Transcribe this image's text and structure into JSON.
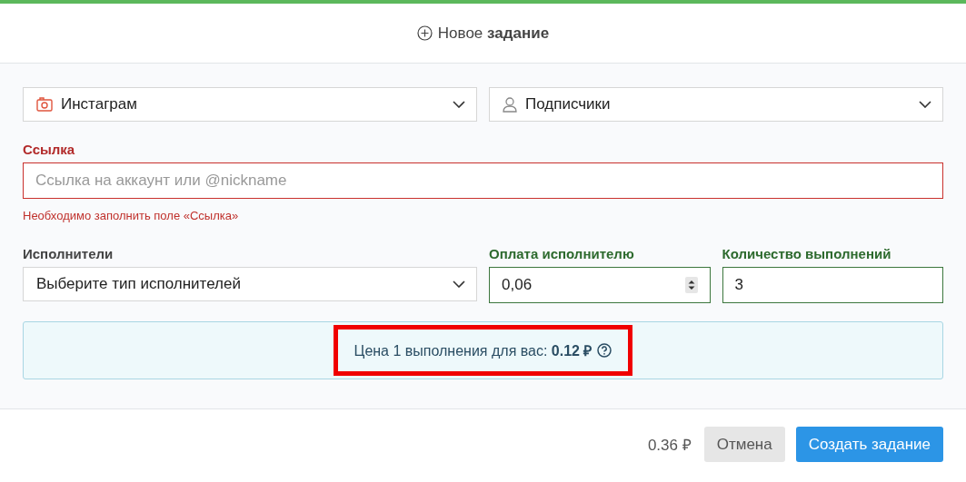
{
  "header": {
    "title": "Новое **задание**"
  },
  "platform": {
    "value": "Инстаграм"
  },
  "service": {
    "value": "Подписчики"
  },
  "link": {
    "label": "Ссылка",
    "placeholder": "Ссылка на аккаунт или @nickname",
    "invalid": true,
    "error": "Необходимо заполнить поле «Ссылка»"
  },
  "performers": {
    "label": "Исполнители",
    "value": "Выберите тип исполнителей",
    "invalid": false,
    "valid": false
  },
  "payment": {
    "label": "Оплата исполнителю",
    "value": "0,06",
    "invalid": false,
    "valid": true
  },
  "count": {
    "label": "Количество выполнений",
    "value": "3",
    "invalid": false,
    "valid": true
  },
  "price_note": {
    "text": "Цена 1 выполнения для вас: **0.12 ₽**",
    "highlighted": true
  },
  "footer": {
    "total": "0.36 ₽",
    "buttons": [
      {
        "label": "Отмена",
        "kind": "secondary"
      },
      {
        "label": "Создать задание",
        "kind": "primary"
      }
    ]
  }
}
